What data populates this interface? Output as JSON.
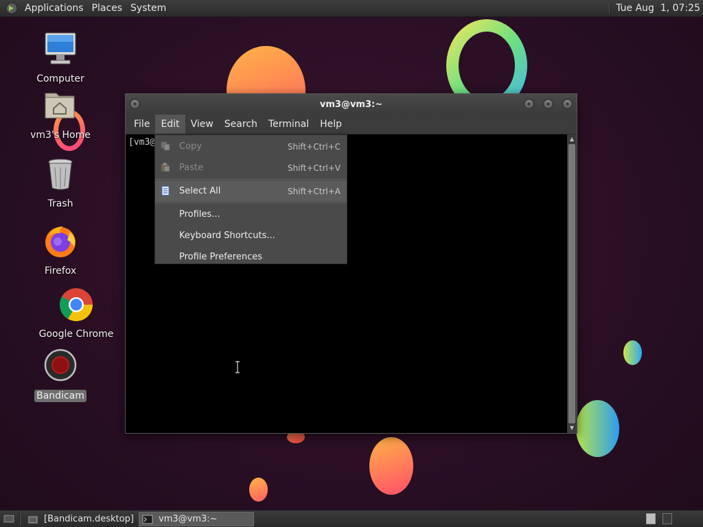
{
  "top_panel": {
    "menus": [
      "Applications",
      "Places",
      "System"
    ],
    "clock": "Tue Aug  1, 07:25"
  },
  "desktop_icons": [
    {
      "label": "Computer",
      "icon": "computer-icon"
    },
    {
      "label": "vm3's Home",
      "icon": "home-folder-icon"
    },
    {
      "label": "Trash",
      "icon": "trash-icon"
    },
    {
      "label": "Firefox",
      "icon": "firefox-icon"
    },
    {
      "label": "Google Chrome",
      "icon": "chrome-icon"
    },
    {
      "label": "Bandicam",
      "icon": "bandicam-icon",
      "selected": true
    }
  ],
  "terminal": {
    "title": "vm3@vm3:~",
    "menus": [
      "File",
      "Edit",
      "View",
      "Search",
      "Terminal",
      "Help"
    ],
    "active_menu": "Edit",
    "prompt_text": "[vm3@"
  },
  "edit_menu": {
    "items": [
      {
        "label": "Copy",
        "accel": "Shift+Ctrl+C",
        "enabled": false,
        "icon": "copy-icon"
      },
      {
        "label": "Paste",
        "accel": "Shift+Ctrl+V",
        "enabled": false,
        "icon": "paste-icon"
      },
      {
        "label": "Select All",
        "accel": "Shift+Ctrl+A",
        "enabled": true,
        "icon": "select-all-icon",
        "hovered": true
      },
      {
        "label": "Profiles...",
        "accel": "",
        "enabled": true
      },
      {
        "label": "Keyboard Shortcuts...",
        "accel": "",
        "enabled": true
      },
      {
        "label": "Profile Preferences",
        "accel": "",
        "enabled": true
      }
    ]
  },
  "taskbar": {
    "tasks": [
      {
        "label": "[Bandicam.desktop]",
        "icon": "file-manager-icon",
        "active": false
      },
      {
        "label": "vm3@vm3:~",
        "icon": "terminal-icon",
        "active": true
      }
    ]
  }
}
